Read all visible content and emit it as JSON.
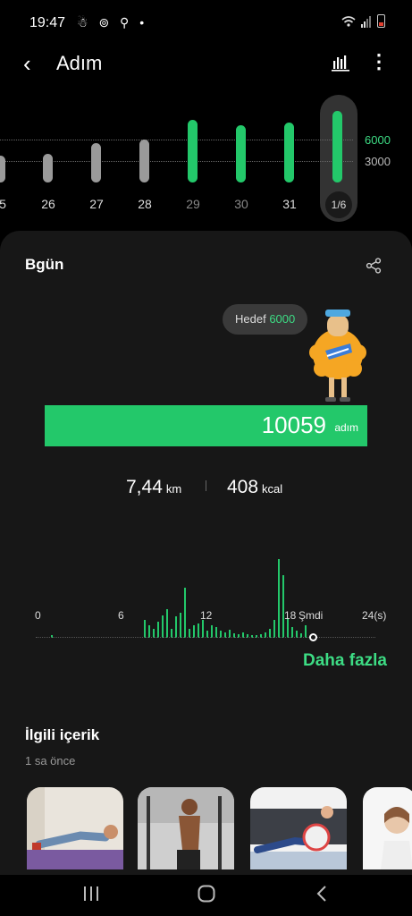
{
  "status": {
    "time": "19:47",
    "left_icons": "☃ ⊚ ⚲ •"
  },
  "appbar": {
    "title": "Adım"
  },
  "weekly": {
    "goal_high": "6000",
    "goal_low": "3000",
    "days": [
      "5",
      "26",
      "27",
      "28",
      "29",
      "30",
      "31"
    ],
    "selected_badge": "1/6"
  },
  "today": {
    "title": "Bgün",
    "goal_prefix": "Hedef",
    "goal_value": "6000",
    "steps_value": "10059",
    "steps_unit": "adım",
    "distance_value": "7,44",
    "distance_unit": "km",
    "calories_value": "408",
    "calories_unit": "kcal",
    "axis": {
      "t0": "0",
      "t6": "6",
      "t12": "12",
      "t18": "18",
      "now": "Şmdi",
      "t24": "24(s)"
    },
    "more_link": "Daha fazla"
  },
  "related": {
    "title": "İlgili içerik",
    "time": "1 sa önce"
  },
  "colors": {
    "accent": "#23c86a",
    "link": "#3ddc84",
    "card": "#171717"
  }
}
